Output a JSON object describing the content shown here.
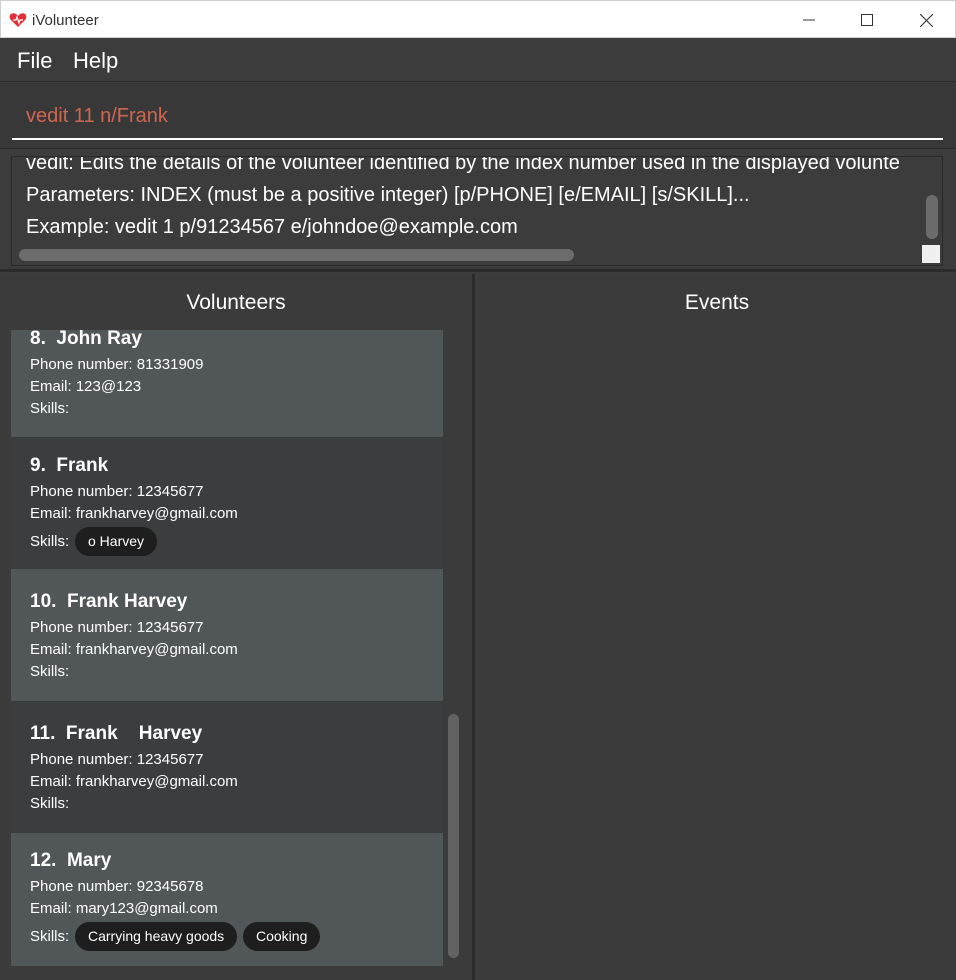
{
  "window": {
    "title": "iVolunteer",
    "app_icon": "heart-icon",
    "controls": [
      "minimize-icon",
      "maximize-icon",
      "close-icon"
    ]
  },
  "menu": {
    "file": "File",
    "help": "Help"
  },
  "command": {
    "value": "vedit 11 n/Frank"
  },
  "result": {
    "lines": [
      "vedit: Edits the details of the volunteer identified by the index number used in the displayed volunte",
      "Parameters: INDEX (must be a positive integer) [p/PHONE] [e/EMAIL] [s/SKILL]...",
      "Example: vedit 1 p/91234567 e/johndoe@example.com"
    ]
  },
  "volunteers_panel": {
    "title": "Volunteers",
    "cards": [
      {
        "name": "8.  John Ray",
        "phone": "Phone number: 81331909",
        "email": "Email: 123@123",
        "skills_label": "Skills:",
        "tags": []
      },
      {
        "name": "9.  Frank",
        "phone": "Phone number: 12345677",
        "email": "Email: frankharvey@gmail.com",
        "skills_label": "Skills:",
        "tags": [
          "o Harvey"
        ]
      },
      {
        "name": "10.  Frank Harvey",
        "phone": "Phone number: 12345677",
        "email": "Email: frankharvey@gmail.com",
        "skills_label": "Skills:",
        "tags": []
      },
      {
        "name": "11.  Frank    Harvey",
        "phone": "Phone number: 12345677",
        "email": "Email: frankharvey@gmail.com",
        "skills_label": "Skills:",
        "tags": []
      },
      {
        "name": "12.  Mary",
        "phone": "Phone number: 92345678",
        "email": "Email: mary123@gmail.com",
        "skills_label": "Skills:",
        "tags": [
          "Carrying heavy goods",
          "Cooking"
        ]
      }
    ]
  },
  "events_panel": {
    "title": "Events"
  },
  "colors": {
    "background": "#3c3c3c",
    "card_light": "#515658",
    "card_dark": "#3b3d3f",
    "command_text": "#d06651",
    "tag_bg": "#1e1e1e"
  }
}
